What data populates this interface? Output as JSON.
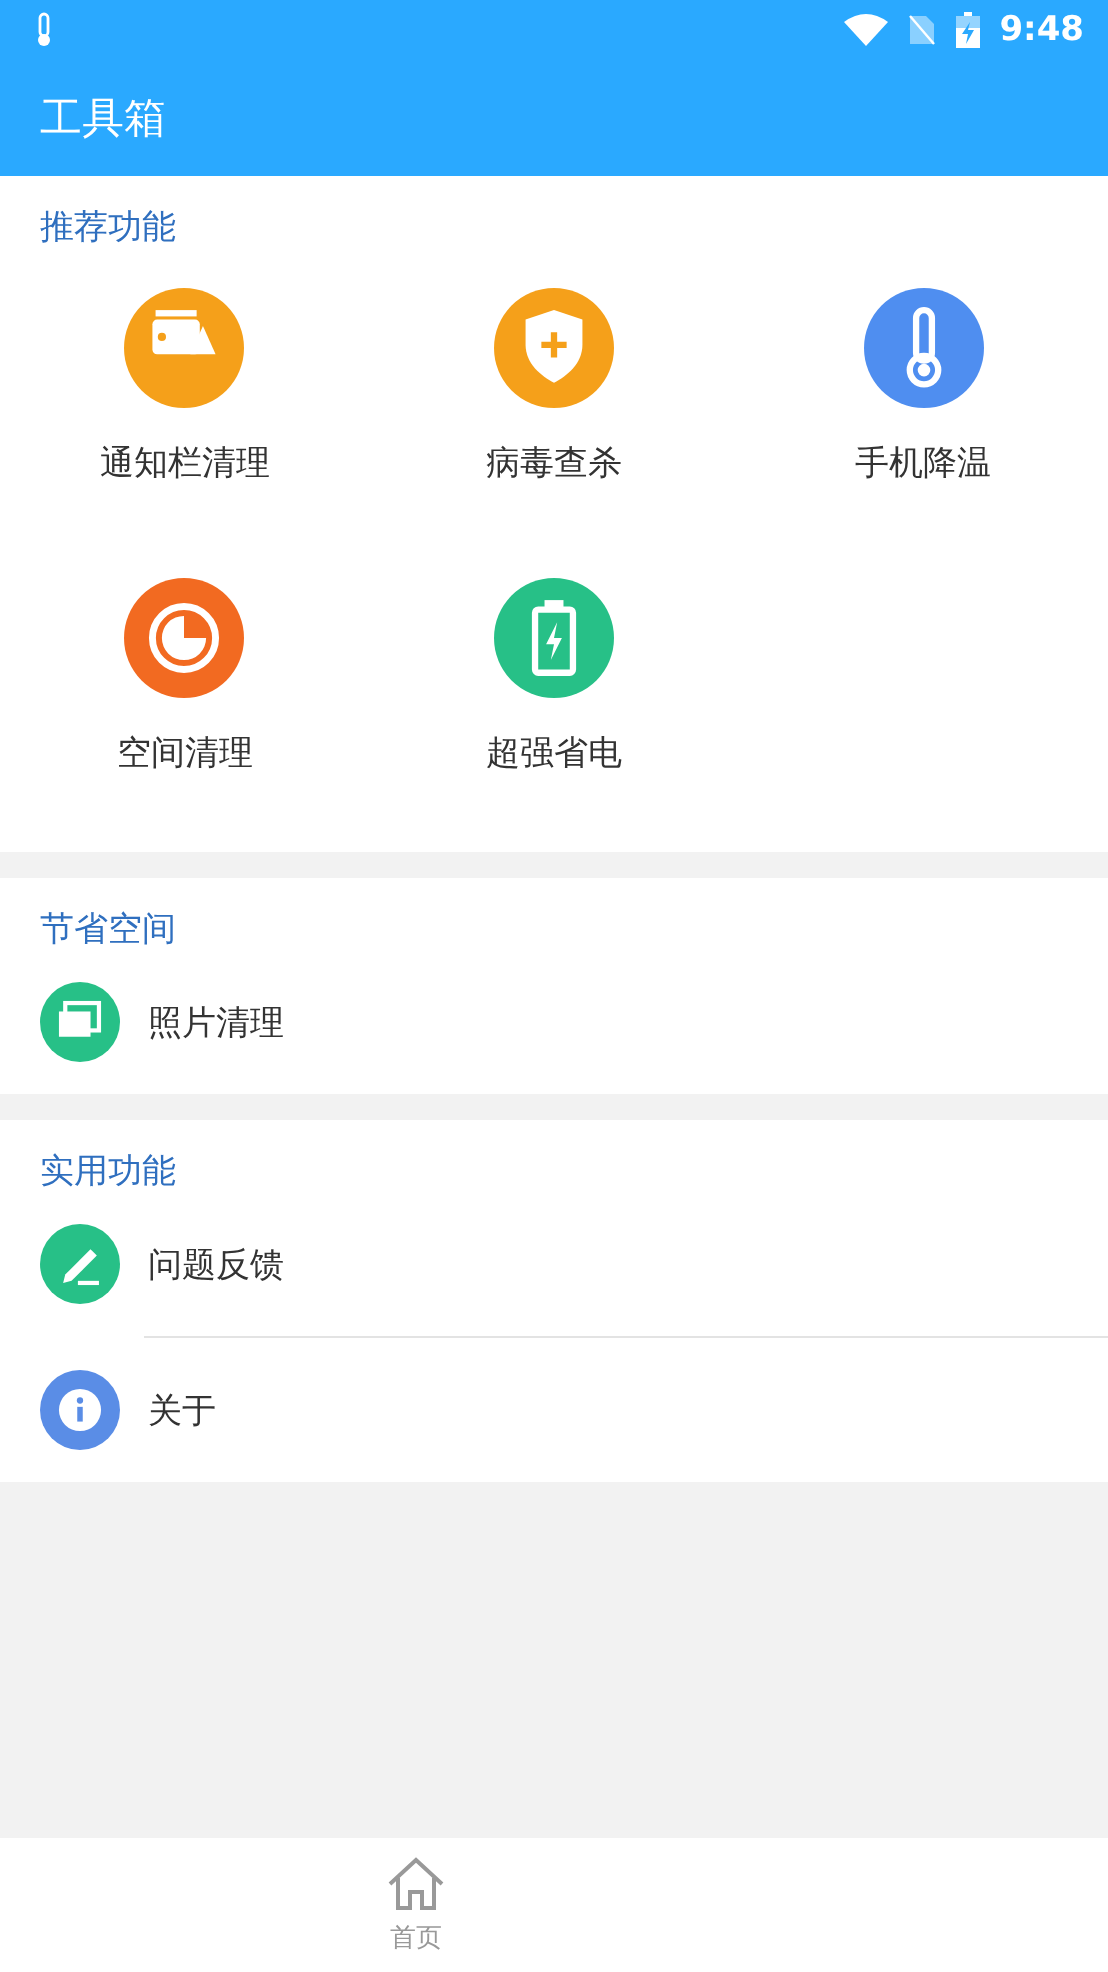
{
  "status_bar": {
    "time": "9:48"
  },
  "app_bar": {
    "title": "工具箱"
  },
  "sections": [
    {
      "title": "推荐功能",
      "kind": "grid",
      "items": [
        {
          "label": "通知栏清理",
          "color": "#f5a01a"
        },
        {
          "label": "病毒查杀",
          "color": "#f5a01a"
        },
        {
          "label": "手机降温",
          "color": "#4f8ef0"
        },
        {
          "label": "空间清理",
          "color": "#f26a21"
        },
        {
          "label": "超强省电",
          "color": "#27c087"
        }
      ]
    },
    {
      "title": "节省空间",
      "kind": "list",
      "items": [
        {
          "label": "照片清理",
          "color": "#27c087"
        }
      ]
    },
    {
      "title": "实用功能",
      "kind": "list",
      "items": [
        {
          "label": "问题反馈",
          "color": "#27c087"
        },
        {
          "label": "关于",
          "color": "#5a8de6"
        }
      ]
    }
  ],
  "bottom_nav": [
    {
      "label": "首页",
      "selected": false
    }
  ]
}
